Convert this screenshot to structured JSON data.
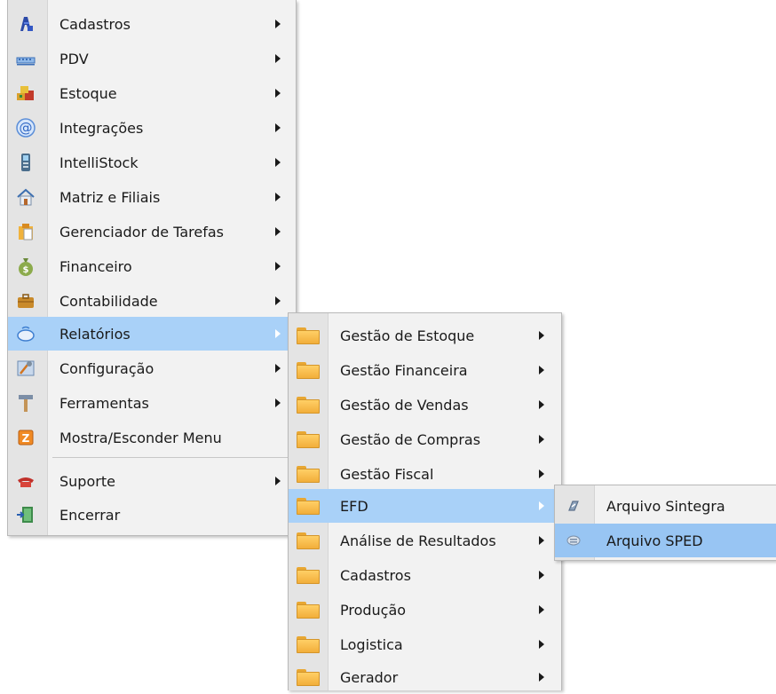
{
  "main_menu": {
    "items": [
      {
        "label": "Cadastros",
        "icon": "user-cards-icon"
      },
      {
        "label": "PDV",
        "icon": "pos-keyboard-icon"
      },
      {
        "label": "Estoque",
        "icon": "stock-boxes-icon"
      },
      {
        "label": "Integrações",
        "icon": "at-sign-icon"
      },
      {
        "label": "IntelliStock",
        "icon": "scanner-device-icon"
      },
      {
        "label": "Matriz e Filiais",
        "icon": "house-icon"
      },
      {
        "label": "Gerenciador de Tarefas",
        "icon": "task-clipboard-icon"
      },
      {
        "label": "Financeiro",
        "icon": "money-bag-icon"
      },
      {
        "label": "Contabilidade",
        "icon": "briefcase-icon"
      },
      {
        "label": "Relatórios",
        "icon": "reports-icon"
      },
      {
        "label": "Configuração",
        "icon": "settings-tools-icon"
      },
      {
        "label": "Ferramentas",
        "icon": "hammer-icon"
      },
      {
        "label": "Mostra/Esconder Menu",
        "icon": "toggle-menu-icon"
      },
      {
        "label": "Suporte",
        "icon": "telephone-icon"
      },
      {
        "label": "Encerrar",
        "icon": "exit-door-icon"
      }
    ]
  },
  "reports_menu": {
    "items": [
      {
        "label": "Gestão de Estoque"
      },
      {
        "label": "Gestão Financeira"
      },
      {
        "label": "Gestão de Vendas"
      },
      {
        "label": "Gestão de Compras"
      },
      {
        "label": "Gestão Fiscal"
      },
      {
        "label": "EFD"
      },
      {
        "label": "Análise de Resultados"
      },
      {
        "label": "Cadastros"
      },
      {
        "label": "Produção"
      },
      {
        "label": "Logistica"
      },
      {
        "label": "Gerador"
      }
    ]
  },
  "efd_menu": {
    "items": [
      {
        "label": "Arquivo Sintegra",
        "icon": "sintegra-link-icon"
      },
      {
        "label": "Arquivo SPED",
        "icon": "sped-disc-icon"
      }
    ]
  },
  "colors": {
    "menu_background": "#f2f2f2",
    "highlight": "#a9d1f8",
    "gutter": "#e4e4e4"
  }
}
